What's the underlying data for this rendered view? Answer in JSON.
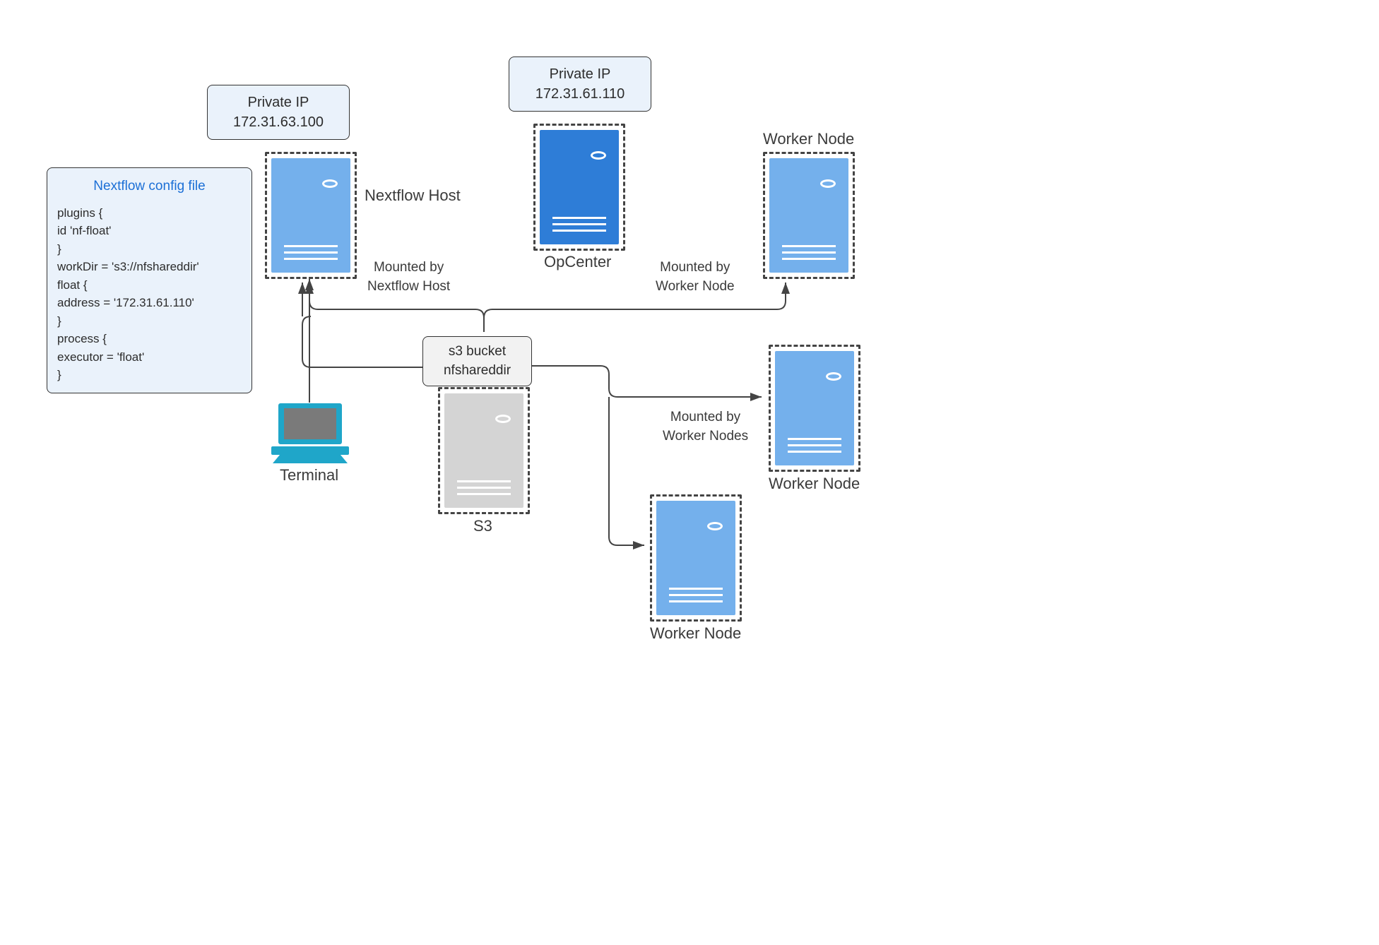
{
  "ip_labels": {
    "nextflow": {
      "title": "Private IP",
      "addr": "172.31.63.100"
    },
    "opcenter": {
      "title": "Private IP",
      "addr": "172.31.61.110"
    }
  },
  "nodes": {
    "nextflow_host": "Nextflow Host",
    "opcenter": "OpCenter",
    "s3": "S3",
    "terminal": "Terminal",
    "worker1": "Worker Node",
    "worker2": "Worker Node",
    "worker3": "Worker Node"
  },
  "s3_bucket": {
    "line1": "s3 bucket",
    "line2": "nfshareddir"
  },
  "mounts": {
    "by_nextflow": {
      "l1": "Mounted by",
      "l2": "Nextflow Host"
    },
    "by_worker": {
      "l1": "Mounted by",
      "l2": "Worker Node"
    },
    "by_workers": {
      "l1": "Mounted by",
      "l2": "Worker Nodes"
    }
  },
  "config": {
    "title": "Nextflow config file",
    "lines": [
      "plugins {",
      " id 'nf-float'",
      "}",
      "workDir = 's3://nfshareddir'",
      "float {",
      " address = '172.31.61.110'",
      "}",
      "process {",
      " executor = 'float'",
      "}"
    ]
  }
}
